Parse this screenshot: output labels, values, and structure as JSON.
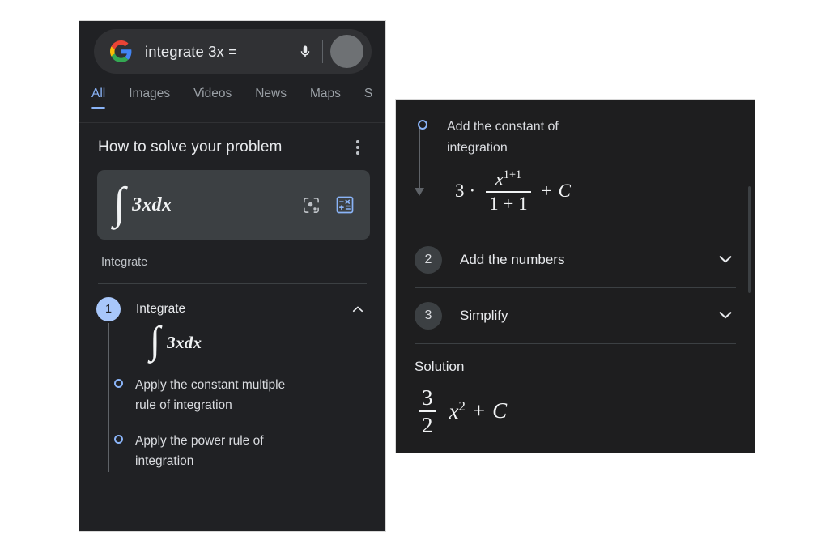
{
  "search": {
    "query": "integrate 3x =",
    "logo_icon": "google-g-logo-icon",
    "mic_icon": "microphone-icon",
    "avatar_icon": "account-avatar-icon"
  },
  "tabs": [
    {
      "label": "All",
      "active": true
    },
    {
      "label": "Images",
      "active": false
    },
    {
      "label": "Videos",
      "active": false
    },
    {
      "label": "News",
      "active": false
    },
    {
      "label": "Maps",
      "active": false
    },
    {
      "label": "S",
      "active": false
    }
  ],
  "card": {
    "title": "How to solve your problem",
    "overflow_icon": "more-vert-icon",
    "input_expression": "3xdx",
    "integral_symbol": "∫",
    "lens_icon": "google-lens-icon",
    "calculator_icon": "math-calculator-icon",
    "subject_label": "Integrate"
  },
  "steps_left": [
    {
      "number": "1",
      "title": "Integrate",
      "state": "expanded",
      "chevron_icon": "chevron-up-icon",
      "expression": "3xdx",
      "bullets": [
        "Apply the constant multiple rule of integration",
        "Apply the power rule of integration"
      ]
    }
  ],
  "right_panel": {
    "continued_bullet": "Add the constant of integration",
    "formula": {
      "coefficient": "3",
      "dot": "·",
      "numerator": "x",
      "numerator_exponent": "1+1",
      "denominator": "1 + 1",
      "plus": "+",
      "constant": "C"
    },
    "steps": [
      {
        "number": "2",
        "title": "Add the numbers",
        "chevron_icon": "chevron-down-icon"
      },
      {
        "number": "3",
        "title": "Simplify",
        "chevron_icon": "chevron-down-icon"
      }
    ],
    "solution_label": "Solution",
    "solution": {
      "numerator": "3",
      "denominator": "2",
      "variable": "x",
      "exponent": "2",
      "plus": "+",
      "constant": "C"
    }
  },
  "colors": {
    "panel_bg": "#202124",
    "right_panel_bg": "#1e1e1f",
    "accent_blue": "#8ab4f8",
    "badge_active": "#a8c7fa",
    "text_primary": "#e8eaed",
    "text_secondary": "#9aa0a6",
    "input_bg": "#3c4043"
  }
}
